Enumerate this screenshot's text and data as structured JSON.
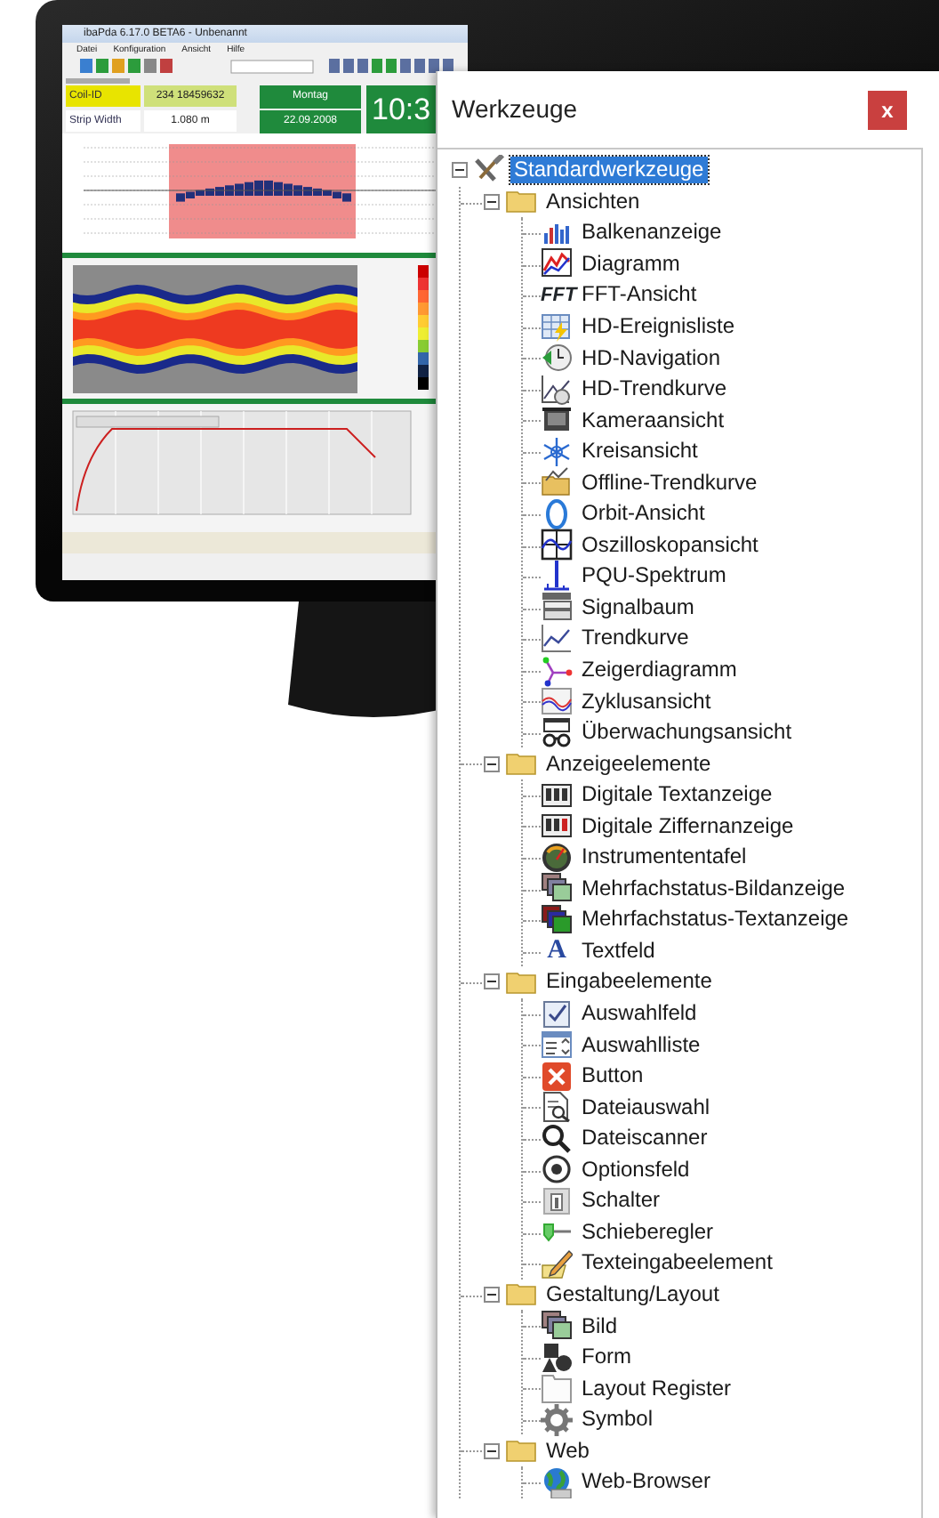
{
  "monitor": {
    "screen": {
      "title": "ibaPda 6.17.0 BETA6 - Unbenannt",
      "menu": [
        "Datei",
        "Konfiguration",
        "Ansicht",
        "Hilfe"
      ],
      "fields": [
        {
          "label": "Coil-ID",
          "value": "234 18459632",
          "highlighted": true
        },
        {
          "label": "Strip Width",
          "value": "1.080 m",
          "highlighted": false
        }
      ],
      "day": "Montag",
      "date": "22.09.2008",
      "time": "10:3"
    }
  },
  "panel": {
    "title": "Werkzeuge",
    "close": "x",
    "tree": {
      "label": "Standardwerkzeuge",
      "kind": "tools",
      "selected": true,
      "expanded": true,
      "children": [
        {
          "label": "Ansichten",
          "kind": "folder",
          "selected": false,
          "expanded": true,
          "children": [
            {
              "label": "Balkenanzeige",
              "kind": "bars",
              "selected": false
            },
            {
              "label": "Diagramm",
              "kind": "chart",
              "selected": false
            },
            {
              "label": "FFT-Ansicht",
              "kind": "text",
              "icon_text": "FFT",
              "selected": false
            },
            {
              "label": "HD-Ereignisliste",
              "kind": "table",
              "selected": false
            },
            {
              "label": "HD-Navigation",
              "kind": "clock",
              "selected": false
            },
            {
              "label": "HD-Trendkurve",
              "kind": "trendclock",
              "selected": false
            },
            {
              "label": "Kameraansicht",
              "kind": "camera",
              "selected": false
            },
            {
              "label": "Kreisansicht",
              "kind": "snowflake",
              "selected": false
            },
            {
              "label": "Offline-Trendkurve",
              "kind": "folderchart",
              "selected": false
            },
            {
              "label": "Orbit-Ansicht",
              "kind": "ring",
              "selected": false
            },
            {
              "label": "Oszilloskopansicht",
              "kind": "scope",
              "selected": false
            },
            {
              "label": "PQU-Spektrum",
              "kind": "spectrum",
              "selected": false
            },
            {
              "label": "Signalbaum",
              "kind": "stack",
              "selected": false
            },
            {
              "label": "Trendkurve",
              "kind": "line",
              "selected": false
            },
            {
              "label": "Zeigerdiagramm",
              "kind": "phasor",
              "selected": false
            },
            {
              "label": "Zyklusansicht",
              "kind": "wave",
              "selected": false
            },
            {
              "label": "Überwachungsansicht",
              "kind": "binoculars",
              "selected": false
            }
          ]
        },
        {
          "label": "Anzeigeelemente",
          "kind": "folder",
          "selected": false,
          "expanded": true,
          "children": [
            {
              "label": "Digitale Textanzeige",
              "kind": "textdisplay",
              "selected": false
            },
            {
              "label": "Digitale Ziffernanzeige",
              "kind": "digitdisplay",
              "selected": false
            },
            {
              "label": "Instrumententafel",
              "kind": "gauge",
              "selected": false
            },
            {
              "label": "Mehrfachstatus-Bildanzeige",
              "kind": "imagestack",
              "selected": false
            },
            {
              "label": "Mehrfachstatus-Textanzeige",
              "kind": "colorstack",
              "selected": false
            },
            {
              "label": "Textfeld",
              "kind": "text",
              "icon_text": "A",
              "selected": false
            }
          ]
        },
        {
          "label": "Eingabeelemente",
          "kind": "folder",
          "selected": false,
          "expanded": true,
          "children": [
            {
              "label": "Auswahlfeld",
              "kind": "checkbox",
              "selected": false
            },
            {
              "label": "Auswahlliste",
              "kind": "listbox",
              "selected": false
            },
            {
              "label": "Button",
              "kind": "xsquare",
              "selected": false
            },
            {
              "label": "Dateiauswahl",
              "kind": "docsearch",
              "selected": false
            },
            {
              "label": "Dateiscanner",
              "kind": "magnifier",
              "selected": false
            },
            {
              "label": "Optionsfeld",
              "kind": "radio",
              "selected": false
            },
            {
              "label": "Schalter",
              "kind": "switch",
              "selected": false
            },
            {
              "label": "Schieberegler",
              "kind": "slider",
              "selected": false
            },
            {
              "label": "Texteingabeelement",
              "kind": "pencil",
              "selected": false
            }
          ]
        },
        {
          "label": "Gestaltung/Layout",
          "kind": "folder",
          "selected": false,
          "expanded": true,
          "children": [
            {
              "label": "Bild",
              "kind": "imagestack",
              "selected": false
            },
            {
              "label": "Form",
              "kind": "shapes",
              "selected": false
            },
            {
              "label": "Layout Register",
              "kind": "tabpage",
              "selected": false
            },
            {
              "label": "Symbol",
              "kind": "gear",
              "selected": false
            }
          ]
        },
        {
          "label": "Web",
          "kind": "folder",
          "selected": false,
          "expanded": true,
          "children": [
            {
              "label": "Web-Browser",
              "kind": "globe",
              "selected": false
            }
          ]
        }
      ]
    }
  }
}
